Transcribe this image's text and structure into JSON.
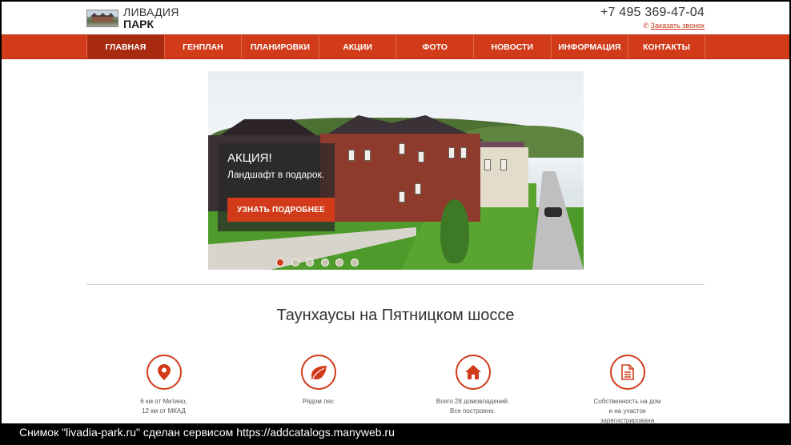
{
  "header": {
    "logo_line1": "ЛИВАДИЯ",
    "logo_line2": "ПАРК",
    "phone": "+7 495 369-47-04",
    "callback_label": "Заказать звонок"
  },
  "nav": {
    "items": [
      {
        "label": "ГЛАВНАЯ",
        "active": true
      },
      {
        "label": "ГЕНПЛАН"
      },
      {
        "label": "ПЛАНИРОВКИ"
      },
      {
        "label": "АКЦИИ"
      },
      {
        "label": "ФОТО"
      },
      {
        "label": "НОВОСТИ"
      },
      {
        "label": "ИНФОРМАЦИЯ"
      },
      {
        "label": "КОНТАКТЫ"
      }
    ]
  },
  "slider": {
    "promo_title": "АКЦИЯ!",
    "promo_text": "Ландшафт в подарок.",
    "promo_button": "УЗНАТЬ ПОДРОБНЕЕ",
    "slide_count": 6,
    "active_slide": 1
  },
  "section": {
    "title": "Таунхаусы на Пятницком шоссе"
  },
  "features": [
    {
      "icon": "map-pin-icon",
      "line1": "6 км от Митино,",
      "line2": "12 км от МКАД",
      "line3": ""
    },
    {
      "icon": "leaf-icon",
      "line1": "Рядом лес",
      "line2": "",
      "line3": ""
    },
    {
      "icon": "home-icon",
      "line1": "Всего 28 домовладений.",
      "line2": "Все построено.",
      "line3": ""
    },
    {
      "icon": "document-icon",
      "line1": "Собственность на дом",
      "line2": "и на участок",
      "line3": "зарегистрирована"
    }
  ],
  "footer_caption": "Снимок \"livadia-park.ru\" сделан сервисом https://addcatalogs.manyweb.ru",
  "colors": {
    "accent": "#d13b19",
    "accent_dark": "#a82b10",
    "dot_inactive": "#c9c3ad"
  }
}
